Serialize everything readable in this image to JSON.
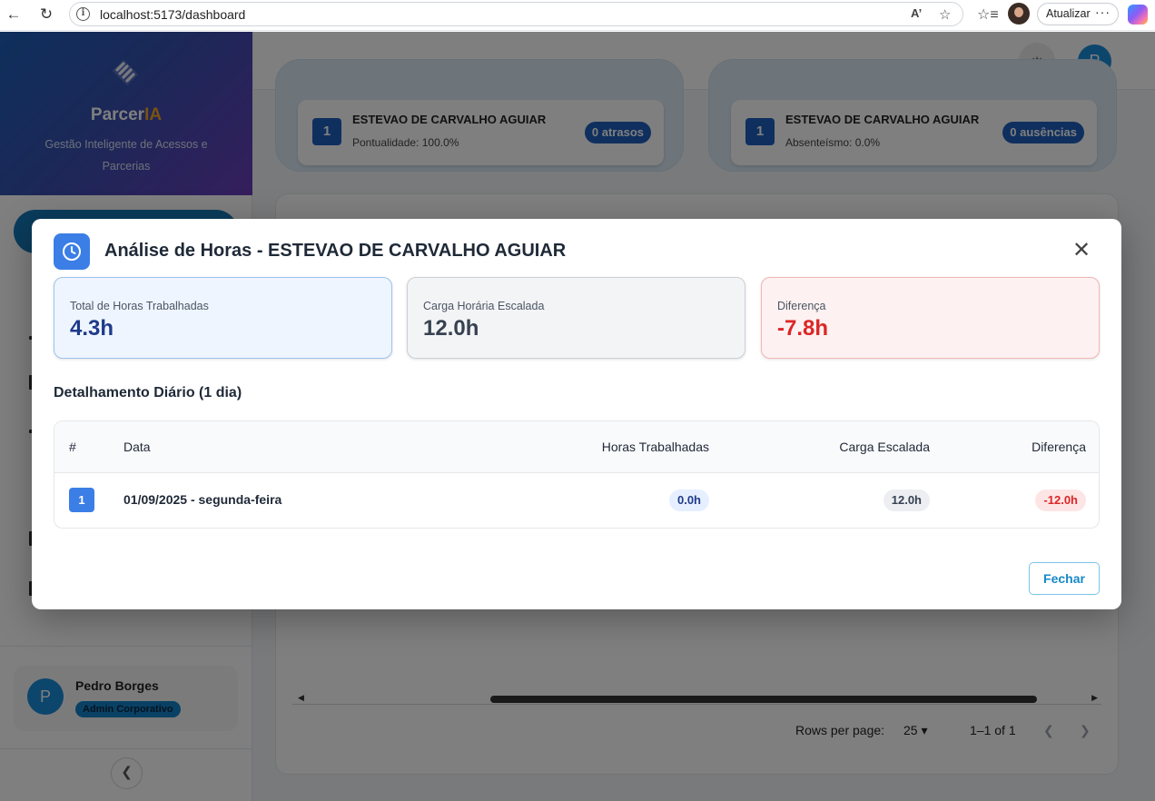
{
  "browser": {
    "url": "localhost:5173/dashboard",
    "update_label": "Atualizar"
  },
  "sidebar": {
    "brand_name_main": "Parcer",
    "brand_name_accent": "IA",
    "brand_subtitle": "Gestão Inteligente de Acessos e Parcerias",
    "user": {
      "initial": "P",
      "name": "Pedro Borges",
      "role": "Admin Corporativo"
    }
  },
  "topbar": {
    "profile_initial": "P"
  },
  "background_cards": [
    {
      "rank": "1",
      "name": "ESTEVAO DE CARVALHO AGUIAR",
      "metric": "Pontualidade: 100.0%",
      "pill": "0 atrasos"
    },
    {
      "rank": "1",
      "name": "ESTEVAO DE CARVALHO AGUIAR",
      "metric": "Absenteísmo: 0.0%",
      "pill": "0 ausências"
    }
  ],
  "pagination": {
    "rows_label": "Rows per page:",
    "rows_value": "25",
    "range": "1–1 of 1"
  },
  "modal": {
    "title": "Análise de Horas - ESTEVAO DE CARVALHO AGUIAR",
    "summary": {
      "worked_label": "Total de Horas Trabalhadas",
      "worked_value": "4.3h",
      "scheduled_label": "Carga Horária Escalada",
      "scheduled_value": "12.0h",
      "diff_label": "Diferença",
      "diff_value": "-7.8h"
    },
    "section_title": "Detalhamento Diário (1 dia)",
    "table": {
      "headers": [
        "#",
        "Data",
        "Horas Trabalhadas",
        "Carga Escalada",
        "Diferença"
      ],
      "rows": [
        {
          "index": "1",
          "date": "01/09/2025 - segunda-feira",
          "worked": "0.0h",
          "scheduled": "12.0h",
          "diff": "-12.0h"
        }
      ]
    },
    "close_label": "Fechar"
  }
}
